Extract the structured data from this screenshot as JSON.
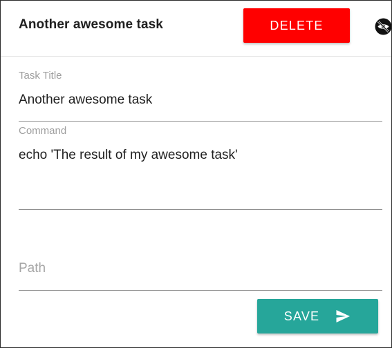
{
  "header": {
    "title": "Another awesome task",
    "delete_label": "DELETE",
    "hide_icon": "visibility-off-icon"
  },
  "form": {
    "task_title": {
      "label": "Task Title",
      "value": "Another awesome task"
    },
    "command": {
      "label": "Command",
      "value": "echo 'The result of my awesome task'"
    },
    "path": {
      "placeholder": "Path",
      "value": ""
    }
  },
  "actions": {
    "save_label": "SAVE",
    "save_icon": "send-icon"
  },
  "colors": {
    "delete": "#ff0000",
    "save": "#26a69a",
    "label": "#9e9e9e",
    "text": "#1f1f1f"
  }
}
